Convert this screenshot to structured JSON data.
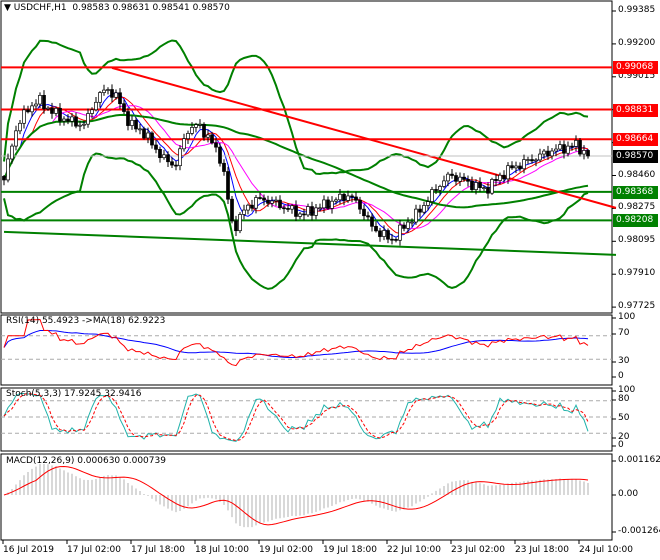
{
  "header": {
    "symbol": "USDCHF,H1",
    "open": "0.98583",
    "high": "0.98631",
    "low": "0.98541",
    "close": "0.98570"
  },
  "colors": {
    "bull": "#ffffff",
    "bear": "#000000",
    "bands": "#008000",
    "resistance": "#ff0000",
    "support": "#008000",
    "current": "#000000"
  },
  "chart_data": [
    {
      "type": "candlestick",
      "title": "USDCHF,H1",
      "bar_count": 147,
      "ylim": [
        0.977,
        0.9942
      ],
      "y_ticks": [
        "0.99385",
        "0.99200",
        "0.99015",
        "0.98830",
        "0.98645",
        "0.98460",
        "0.98275",
        "0.98095",
        "0.97910",
        "0.97725"
      ],
      "x_ticks": [
        "16 Jul 2019",
        "17 Jul 02:00",
        "17 Jul 18:00",
        "18 Jul 10:00",
        "19 Jul 02:00",
        "19 Jul 18:00",
        "22 Jul 10:00",
        "23 Jul 02:00",
        "23 Jul 18:00",
        "24 Jul 10:00"
      ],
      "price_path": [
        0.98435,
        0.98716,
        0.98829,
        0.98885,
        0.98829,
        0.98784,
        0.98761,
        0.98744,
        0.98885,
        0.98952,
        0.98885,
        0.98744,
        0.98716,
        0.98632,
        0.98548,
        0.9852,
        0.98716,
        0.98744,
        0.9866,
        0.98548,
        0.98154,
        0.98267,
        0.98323,
        0.98323,
        0.98295,
        0.98267,
        0.98239,
        0.98267,
        0.98295,
        0.98323,
        0.98351,
        0.98295,
        0.98182,
        0.98126,
        0.98098,
        0.98182,
        0.98239,
        0.98323,
        0.98407,
        0.98463,
        0.98435,
        0.98407,
        0.98379,
        0.98435,
        0.98491,
        0.9852,
        0.98548,
        0.98576,
        0.98604,
        0.98615,
        0.98632,
        0.9857
      ],
      "levels": [
        {
          "label": "0.99068",
          "price": 0.99068,
          "kind": "resistance"
        },
        {
          "label": "0.98831",
          "price": 0.98831,
          "kind": "resistance"
        },
        {
          "label": "0.98664",
          "price": 0.98664,
          "kind": "resistance"
        },
        {
          "label": "0.98368",
          "price": 0.98368,
          "kind": "support"
        },
        {
          "label": "0.98208",
          "price": 0.98208,
          "kind": "support"
        }
      ],
      "current_price": "0.98570",
      "trendlines": [
        {
          "kind": "resistance",
          "from_bar": 27,
          "from_price": 0.99065,
          "to_bar": 153,
          "to_price": 0.98278
        },
        {
          "kind": "support",
          "from_bar": 0,
          "from_price": 0.98143,
          "to_bar": 153,
          "to_price": 0.98014
        }
      ],
      "bollinger": {
        "period": 20,
        "deviation": 2.6
      },
      "moving_averages": [
        {
          "period": 5,
          "color": "#0000ff"
        },
        {
          "period": 8,
          "color": "#ff0000"
        },
        {
          "period": 13,
          "color": "#ff00ff"
        },
        {
          "period": 60,
          "color": "#008000"
        }
      ]
    },
    {
      "type": "line",
      "title": "RSI(14) 55.4923  ->MA(18) 62.9223",
      "ylim": [
        0,
        100
      ],
      "y_ticks": [
        "100",
        "70",
        "30",
        "0"
      ],
      "levels": [
        70,
        30
      ],
      "period": 14,
      "ma_period": 18
    },
    {
      "type": "line",
      "title": "Stoch(5,3,3) 17.9245 32.9416",
      "ylim": [
        0,
        100
      ],
      "y_ticks": [
        "100",
        "80",
        "50",
        "20",
        "0"
      ],
      "levels": [
        80,
        50,
        20
      ]
    },
    {
      "type": "bar",
      "title": "MACD(12,26,9) 0.000630 0.000739",
      "ylim": [
        -0.001264,
        0.001162
      ],
      "y_ticks": [
        "0.001162",
        "0.00",
        "-0.001264"
      ]
    }
  ]
}
